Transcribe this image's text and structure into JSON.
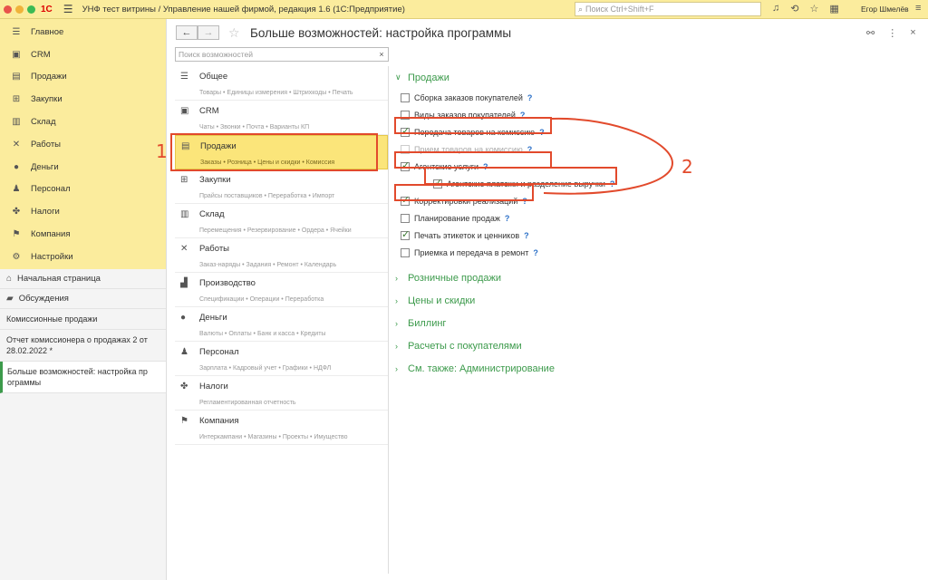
{
  "titlebar": {
    "logo": "1С",
    "title": "УНФ тест витрины / Управление нашей фирмой, редакция 1.6  (1С:Предприятие)",
    "search_placeholder": "Поиск Ctrl+Shift+F",
    "user": "Егор Шмелёв"
  },
  "sections": [
    {
      "label": "Главное",
      "icon": "menu-icon"
    },
    {
      "label": "CRM",
      "icon": "crm-icon"
    },
    {
      "label": "Продажи",
      "icon": "sales-icon"
    },
    {
      "label": "Закупки",
      "icon": "purchases-icon"
    },
    {
      "label": "Склад",
      "icon": "warehouse-icon"
    },
    {
      "label": "Работы",
      "icon": "tools-icon"
    },
    {
      "label": "Деньги",
      "icon": "money-icon"
    },
    {
      "label": "Персонал",
      "icon": "staff-icon"
    },
    {
      "label": "Налоги",
      "icon": "taxes-icon"
    },
    {
      "label": "Компания",
      "icon": "flag-icon"
    },
    {
      "label": "Настройки",
      "icon": "gear-icon"
    }
  ],
  "nav": {
    "home": "Начальная страница",
    "discussions": "Обсуждения",
    "open_windows": [
      "Комиссионные продажи",
      "Отчет комиссионера о продажах 2 от 28.02.2022  *",
      "Больше возможностей: настройка пр ограммы"
    ]
  },
  "page": {
    "title": "Больше возможностей: настройка программы",
    "search_placeholder": "Поиск возможностей",
    "clear": "×"
  },
  "categories": [
    {
      "title": "Общее",
      "sub": "Товары • Единицы измерения • Штрихкоды • Печать"
    },
    {
      "title": "CRM",
      "sub": "Чаты • Звонки • Почта • Варианты КП"
    },
    {
      "title": "Продажи",
      "sub": "Заказы • Розница • Цены и скидки • Комиссия"
    },
    {
      "title": "Закупки",
      "sub": "Прайсы поставщиков • Переработка • Импорт"
    },
    {
      "title": "Склад",
      "sub": "Перемещения • Резервирование • Ордера • Ячейки"
    },
    {
      "title": "Работы",
      "sub": "Заказ-наряды • Задания • Ремонт • Календарь"
    },
    {
      "title": "Производство",
      "sub": "Спецификации • Операции • Переработка"
    },
    {
      "title": "Деньги",
      "sub": "Валюты • Оплаты • Банк и касса • Кредиты"
    },
    {
      "title": "Персонал",
      "sub": "Зарплата • Кадровый учет • Графики • НДФЛ"
    },
    {
      "title": "Налоги",
      "sub": "Регламентированная отчетность"
    },
    {
      "title": "Компания",
      "sub": "Интеркампани • Магазины • Проекты • Имущество"
    }
  ],
  "sales_group": {
    "title": "Продажи",
    "options": [
      {
        "label": "Сборка заказов покупателей",
        "checked": false
      },
      {
        "label": "Виды заказов покупателей",
        "checked": false
      },
      {
        "label": "Передача товаров на комиссию",
        "checked": true
      },
      {
        "label": "Прием товаров на комиссию",
        "checked": false
      },
      {
        "label": "Агентские услуги",
        "checked": true
      },
      {
        "label": "Агентские платежи и разделение выручки",
        "checked": true
      },
      {
        "label": "Корректировки реализаций",
        "checked": true
      },
      {
        "label": "Планирование продаж",
        "checked": false
      },
      {
        "label": "Печать этикеток и ценников",
        "checked": true
      },
      {
        "label": "Приемка и передача в ремонт",
        "checked": false
      }
    ]
  },
  "collapsed_groups": [
    "Розничные продажи",
    "Цены и скидки",
    "Биллинг",
    "Расчеты с покупателями",
    "См. также: Администрирование"
  ],
  "annotations": {
    "one": "1",
    "two": "2"
  },
  "help_mark": "?"
}
